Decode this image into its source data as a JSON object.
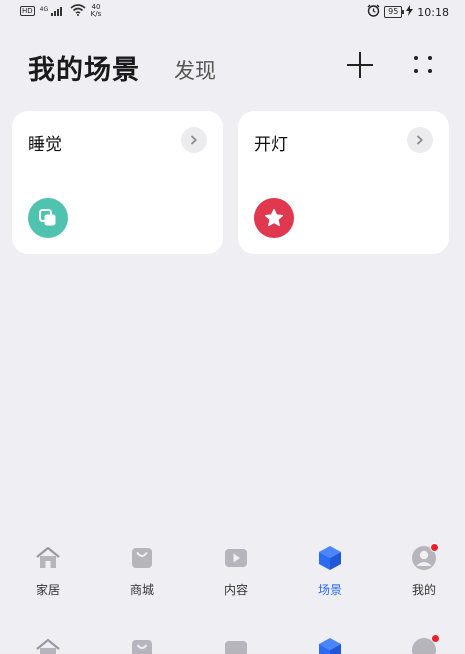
{
  "status_bar": {
    "left_badge": "HD",
    "network": "4G",
    "speed_value": "40",
    "speed_unit": "K/s",
    "battery": "95",
    "time": "10:18"
  },
  "header": {
    "title": "我的场景",
    "tab_discover": "发现"
  },
  "scenes": [
    {
      "name": "睡觉",
      "icon": "copy-icon",
      "color": "#4fc3b0"
    },
    {
      "name": "开灯",
      "icon": "star-icon",
      "color": "#e0384e"
    }
  ],
  "nav": {
    "items": [
      {
        "label": "家居",
        "icon": "home-icon"
      },
      {
        "label": "商城",
        "icon": "shopping-bag-icon"
      },
      {
        "label": "内容",
        "icon": "play-icon"
      },
      {
        "label": "场景",
        "icon": "cube-icon"
      },
      {
        "label": "我的",
        "icon": "avatar-icon"
      }
    ],
    "active_index": 3,
    "active_color": "#2b6cf0",
    "badge_color": "#e8202b"
  }
}
